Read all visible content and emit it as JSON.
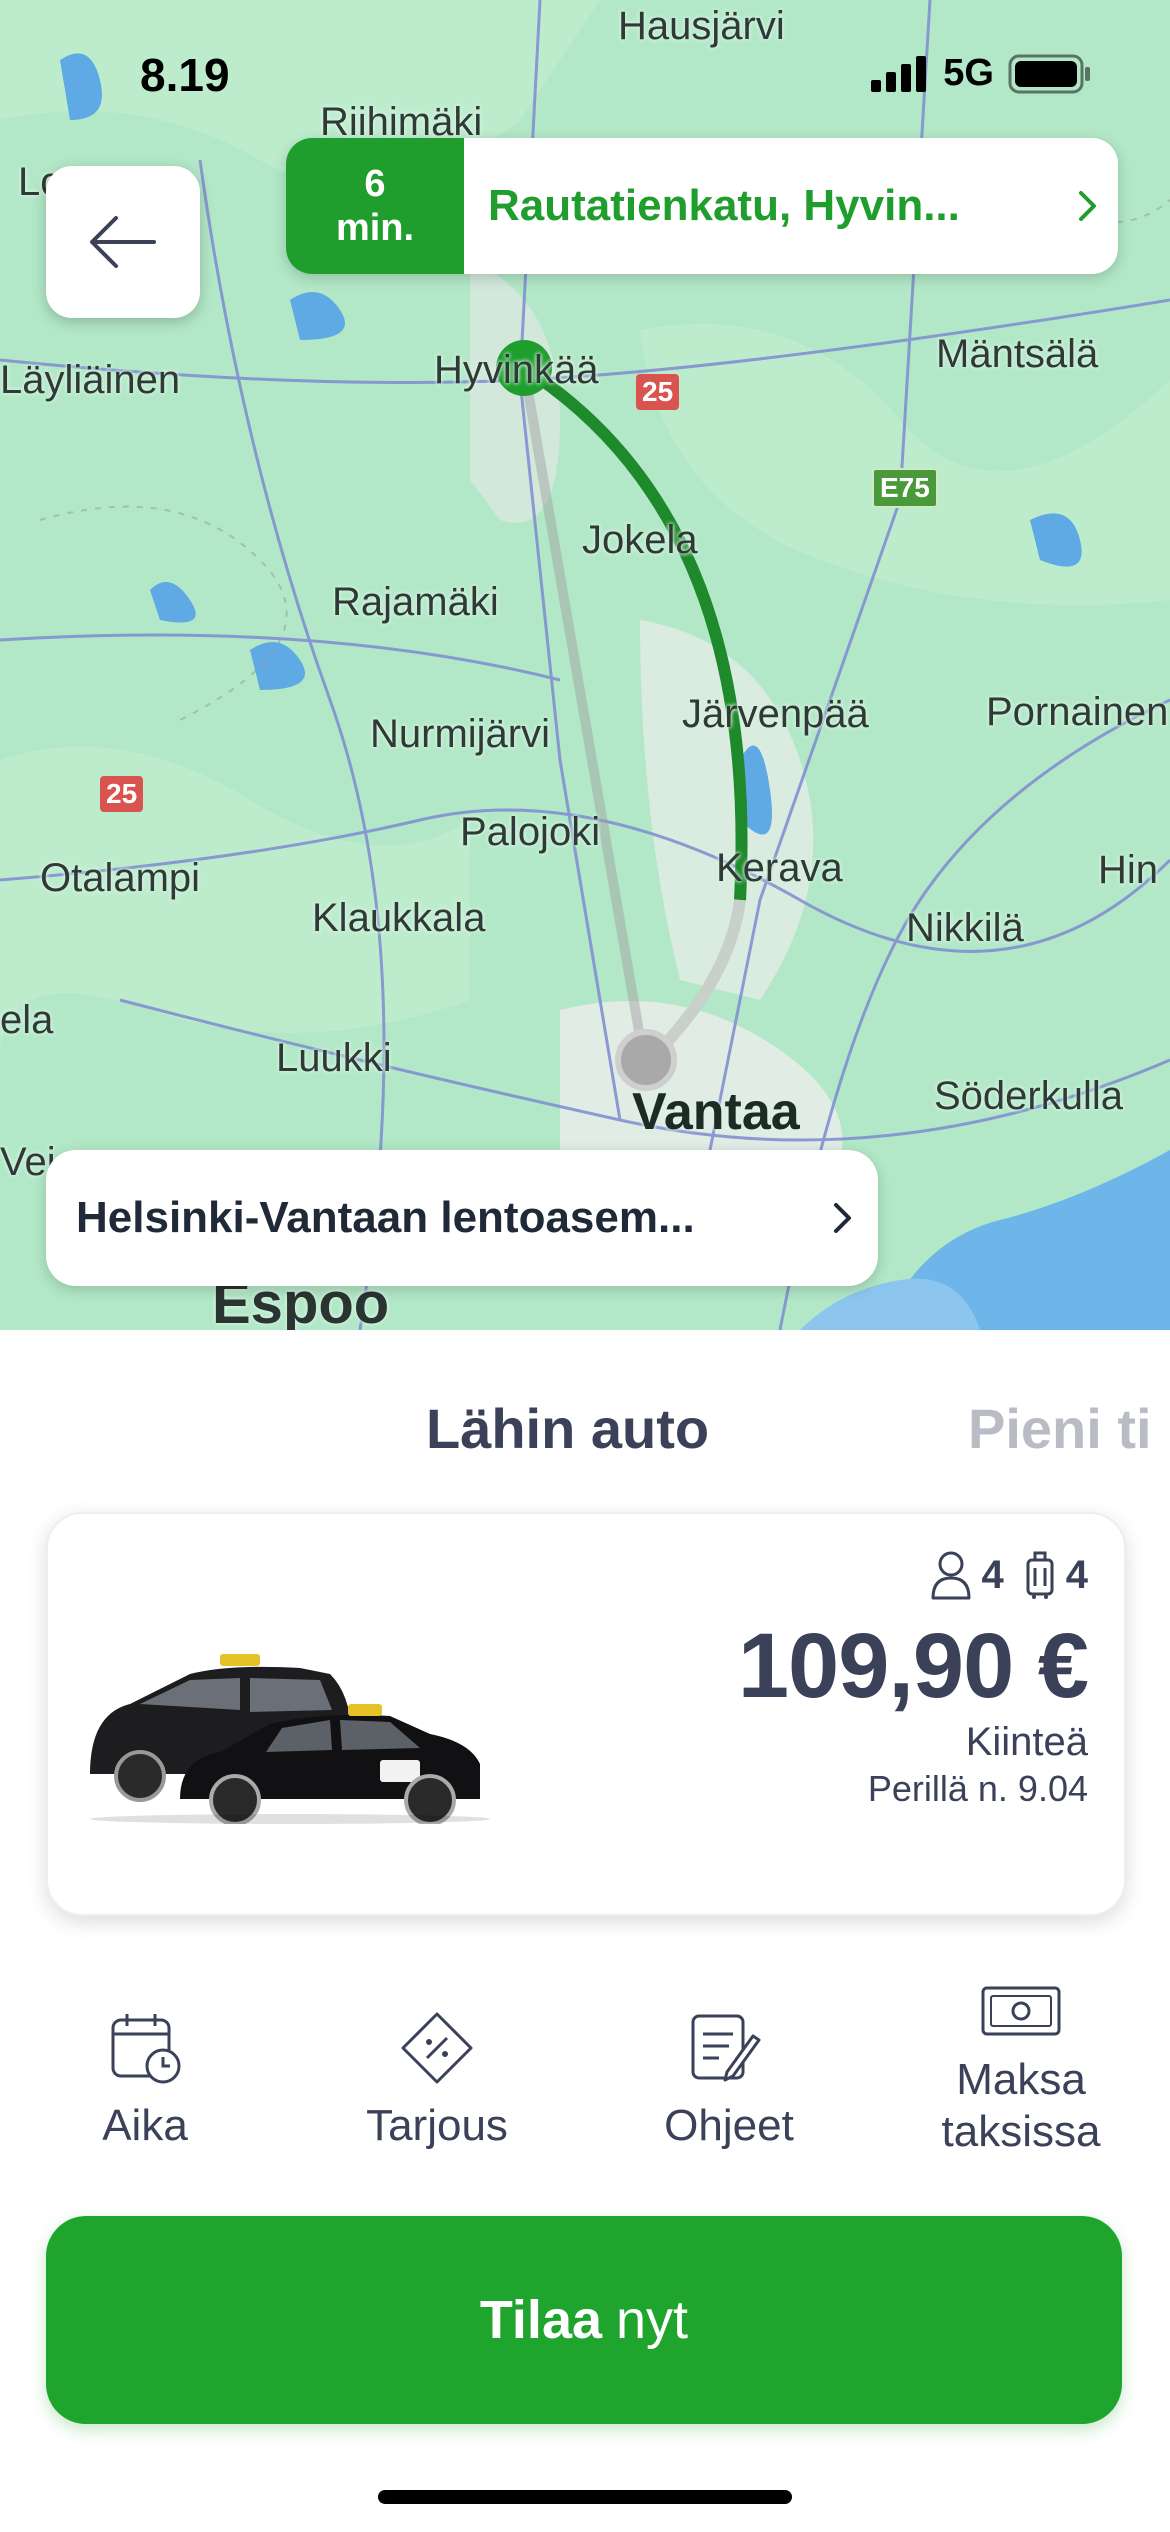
{
  "status_bar": {
    "time": "8.19",
    "network": "5G"
  },
  "map": {
    "places": [
      {
        "name": "Hausjärvi"
      },
      {
        "name": "Riihimäki"
      },
      {
        "name": "Lo"
      },
      {
        "name": "Läyliäinen"
      },
      {
        "name": "Hyvinkää"
      },
      {
        "name": "Mäntsälä"
      },
      {
        "name": "Jokela"
      },
      {
        "name": "Rajamäki"
      },
      {
        "name": "Nurmijärvi"
      },
      {
        "name": "Järvenpää"
      },
      {
        "name": "Pornainen"
      },
      {
        "name": "Palojoki"
      },
      {
        "name": "Otalampi"
      },
      {
        "name": "Kerava"
      },
      {
        "name": "Hin"
      },
      {
        "name": "Klaukkala"
      },
      {
        "name": "Nikkilä"
      },
      {
        "name": "ela"
      },
      {
        "name": "Luukki"
      },
      {
        "name": "Söderkulla"
      },
      {
        "name": "Vantaa"
      },
      {
        "name": "Vei"
      },
      {
        "name": "Espoo"
      }
    ],
    "road_shields": [
      "25",
      "E75",
      "25"
    ]
  },
  "pickup": {
    "eta_value": "6",
    "eta_unit": "min.",
    "address": "Rautatienkatu, Hyvin..."
  },
  "destination": {
    "address": "Helsinki-Vantaan lentoasem..."
  },
  "tabs": {
    "active": "Lähin auto",
    "next": "Pieni ti"
  },
  "offer": {
    "passengers": "4",
    "luggage": "4",
    "price": "109,90 €",
    "price_type": "Kiinteä",
    "arrival": "Perillä n. 9.04"
  },
  "options": [
    {
      "label": "Aika",
      "icon": "calendar-clock-icon"
    },
    {
      "label": "Tarjous",
      "icon": "voucher-icon"
    },
    {
      "label": "Ohjeet",
      "icon": "note-edit-icon"
    },
    {
      "label": "Maksa taksissa",
      "icon": "cash-icon"
    }
  ],
  "order_button": {
    "bold": "Tilaa",
    "rest": "nyt"
  },
  "colors": {
    "brand_green": "#1fa42d",
    "text_dark": "#3a4158",
    "map_bg": "#a9e4c0"
  }
}
